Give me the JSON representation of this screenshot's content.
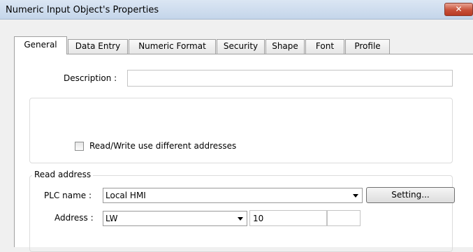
{
  "window": {
    "title": "Numeric Input Object's Properties",
    "close_glyph": "✕"
  },
  "tabs": [
    {
      "label": "General",
      "active": true
    },
    {
      "label": "Data Entry"
    },
    {
      "label": "Numeric Format"
    },
    {
      "label": "Security"
    },
    {
      "label": "Shape"
    },
    {
      "label": "Font"
    },
    {
      "label": "Profile"
    }
  ],
  "general": {
    "description_label": "Description :",
    "description_value": "",
    "rw_checkbox_label": "Read/Write use different addresses",
    "rw_checkbox_checked": false
  },
  "read_address": {
    "group_label": "Read address",
    "plc_name_label": "PLC name :",
    "plc_name_value": "Local HMI",
    "setting_button": "Setting...",
    "address_label": "Address :",
    "address_type": "LW",
    "address_value": "10",
    "address_extra": ""
  }
}
